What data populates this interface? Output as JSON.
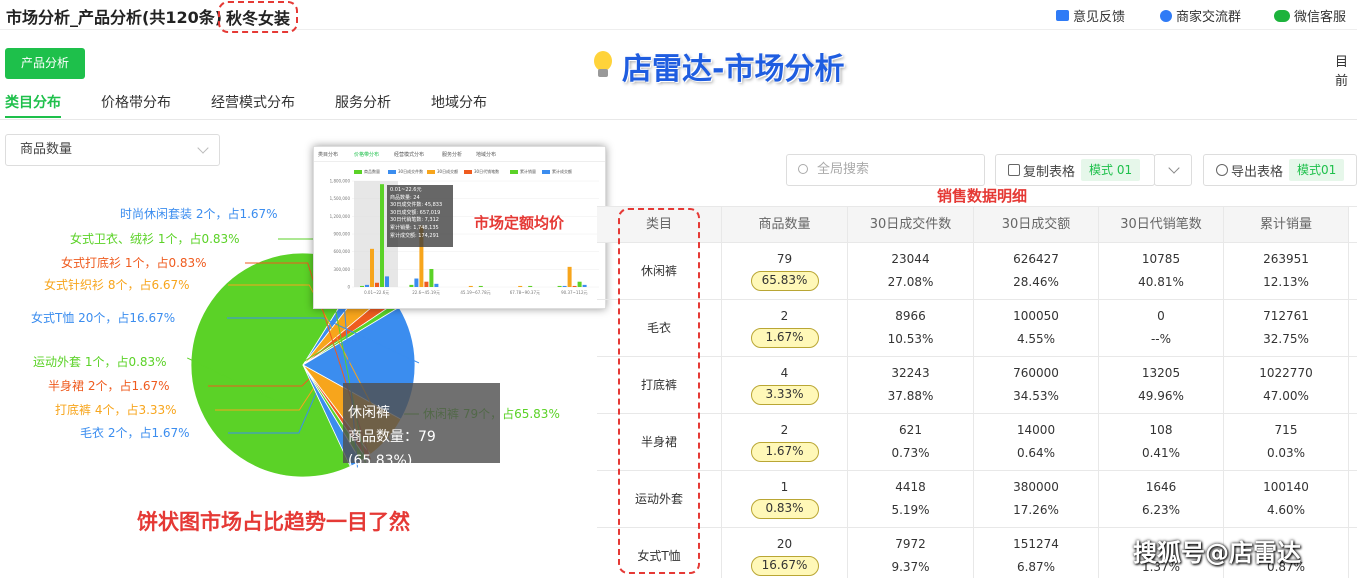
{
  "header": {
    "title": "市场分析_产品分析(共120条)",
    "season": "秋冬女装",
    "links": [
      "意见反馈",
      "商家交流群",
      "微信客服"
    ]
  },
  "brand": "店雷达-市场分析",
  "product_btn": "产品分析",
  "edge_text": "目前",
  "tabs": [
    "类目分布",
    "价格带分布",
    "经营模式分布",
    "服务分析",
    "地域分布"
  ],
  "metric_select": "商品数量",
  "chart_data": {
    "type": "pie",
    "slices": [
      {
        "name": "休闲裤",
        "count": 79,
        "percent": 65.83,
        "color": "#5bd227",
        "label": "休闲裤 79个，占65.83%"
      },
      {
        "name": "毛衣",
        "count": 2,
        "percent": 1.67,
        "color": "#3b8def",
        "label": "毛衣 2个，占1.67%"
      },
      {
        "name": "打底裤",
        "count": 4,
        "percent": 3.33,
        "color": "#f7a51c",
        "label": "打底裤 4个，占3.33%"
      },
      {
        "name": "半身裙",
        "count": 2,
        "percent": 1.67,
        "color": "#ef5b1f",
        "label": "半身裙 2个，占1.67%"
      },
      {
        "name": "运动外套",
        "count": 1,
        "percent": 0.83,
        "color": "#5bd227",
        "label": "运动外套 1个，占0.83%"
      },
      {
        "name": "女式T恤",
        "count": 20,
        "percent": 16.67,
        "color": "#3b8def",
        "label": "女式T恤 20个，占16.67%"
      },
      {
        "name": "女式针织衫",
        "count": 8,
        "percent": 6.67,
        "color": "#f7a51c",
        "label": "女式针织衫 8个，占6.67%"
      },
      {
        "name": "女式打底衫",
        "count": 1,
        "percent": 0.83,
        "color": "#ef5b1f",
        "label": "女式打底衫 1个，占0.83%"
      },
      {
        "name": "女式卫衣、绒衫",
        "count": 1,
        "percent": 0.83,
        "color": "#5bd227",
        "label": "女式卫衣、绒衫 1个，占0.83%"
      },
      {
        "name": "时尚休闲套装",
        "count": 2,
        "percent": 1.67,
        "color": "#3b8def",
        "label": "时尚休闲套装 2个，占1.67%"
      }
    ]
  },
  "tooltip": {
    "name": "休闲裤",
    "line": "商品数量：79 (65.83%)"
  },
  "caption": "饼状图市场占比趋势一目了然",
  "inset": {
    "tabs": [
      "类目分布",
      "价格带分布",
      "经营模式分布",
      "服务分析",
      "地域分布"
    ],
    "legend": [
      {
        "name": "商品数量",
        "color": "#5bd227"
      },
      {
        "name": "30日成交件数",
        "color": "#3b8def"
      },
      {
        "name": "30日成交额",
        "color": "#f7a51c"
      },
      {
        "name": "30日代销笔数",
        "color": "#ef5b1f"
      },
      {
        "name": "累计销量",
        "color": "#5bd227"
      },
      {
        "name": "累计成交额",
        "color": "#3b8def"
      }
    ],
    "y_ticks": [
      "1,800,000",
      "1,500,000",
      "1,200,000",
      "900,000",
      "600,000",
      "300,000",
      "0"
    ],
    "x_ticks": [
      "0.01~22.6元",
      "22.6~45.19元",
      "45.19~67.78元",
      "67.78~90.37元",
      "90.37~112元"
    ],
    "tooltip": [
      "0.01~22.6元",
      "商品数量: 24",
      "30日成交件数: 45,833",
      "30日成交额: 657,019",
      "30日代销笔数: 7,312",
      "累计销量: 1,748,135",
      "累计成交额: 174,291"
    ],
    "label": "市场定额均价"
  },
  "toolbar": {
    "search_placeholder": "全局搜索",
    "copy": "复制表格",
    "copy_mode": "模式 01",
    "export": "导出表格",
    "export_mode": "模式01"
  },
  "sales_label": "销售数据明细",
  "table": {
    "headers": [
      "类目",
      "商品数量",
      "30日成交件数",
      "30日成交额",
      "30日代销笔数",
      "累计销量"
    ],
    "rows": [
      {
        "cat": "休闲裤",
        "qty": "79",
        "qty_pct": "65.83%",
        "c1": "23044",
        "c1p": "27.08%",
        "c2": "626427",
        "c2p": "28.46%",
        "c3": "10785",
        "c3p": "40.81%",
        "c4": "263951",
        "c4p": "12.13%"
      },
      {
        "cat": "毛衣",
        "qty": "2",
        "qty_pct": "1.67%",
        "c1": "8966",
        "c1p": "10.53%",
        "c2": "100050",
        "c2p": "4.55%",
        "c3": "0",
        "c3p": "--%",
        "c4": "712761",
        "c4p": "32.75%"
      },
      {
        "cat": "打底裤",
        "qty": "4",
        "qty_pct": "3.33%",
        "c1": "32243",
        "c1p": "37.88%",
        "c2": "760000",
        "c2p": "34.53%",
        "c3": "13205",
        "c3p": "49.96%",
        "c4": "1022770",
        "c4p": "47.00%"
      },
      {
        "cat": "半身裙",
        "qty": "2",
        "qty_pct": "1.67%",
        "c1": "621",
        "c1p": "0.73%",
        "c2": "14000",
        "c2p": "0.64%",
        "c3": "108",
        "c3p": "0.41%",
        "c4": "715",
        "c4p": "0.03%"
      },
      {
        "cat": "运动外套",
        "qty": "1",
        "qty_pct": "0.83%",
        "c1": "4418",
        "c1p": "5.19%",
        "c2": "380000",
        "c2p": "17.26%",
        "c3": "1646",
        "c3p": "6.23%",
        "c4": "100140",
        "c4p": "4.60%"
      },
      {
        "cat": "女式T恤",
        "qty": "20",
        "qty_pct": "16.67%",
        "c1": "7972",
        "c1p": "9.37%",
        "c2": "151274",
        "c2p": "6.87%",
        "c3": "",
        "c3p": "1.37%",
        "c4": "",
        "c4p": "0.87%"
      }
    ]
  },
  "watermark": "搜狐号@店雷达"
}
